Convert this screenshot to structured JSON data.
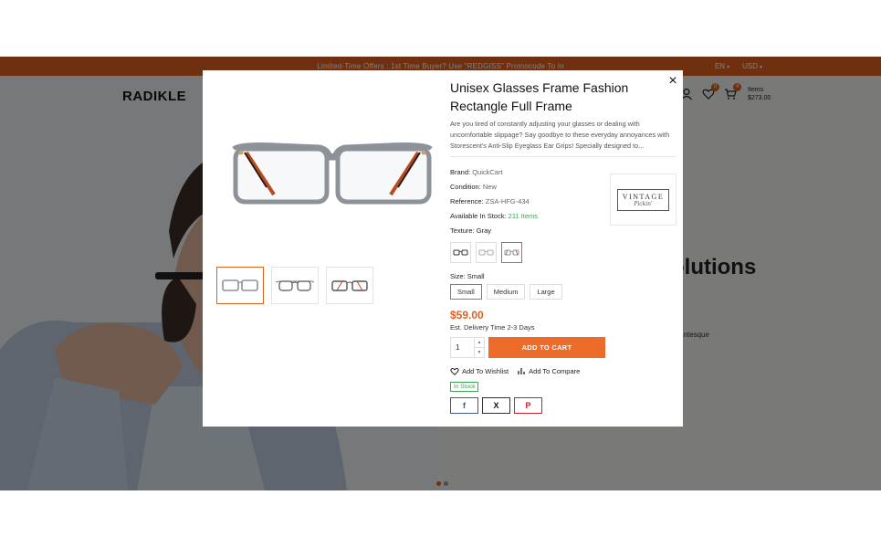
{
  "topbar": {
    "promo": "Limited-Time Offers : 1st Time Buyer? Use \"REDGISS\" Promocode To In",
    "language": "EN",
    "currency": "USD"
  },
  "header": {
    "logo": "RADIKLE",
    "wishlist_count": "0",
    "cart_count": "4",
    "cart_label": "Items",
    "cart_total": "$273.00",
    "icons": [
      "user-icon",
      "heart-icon",
      "cart-icon"
    ]
  },
  "hero": {
    "title": "olutions",
    "text_fragment": "entesque"
  },
  "modal": {
    "close": "×",
    "product": {
      "title": "Unisex Glasses Frame Fashion Rectangle Full Frame",
      "description": "Are you tired of constantly adjusting your glasses or dealing with uncomfortable slippage? Say goodbye to these everyday annoyances with Storescent's Anti-Slip Eyeglass Ear Grips! Specially designed to...",
      "brand_label": "Brand:",
      "brand": "QuickCart",
      "condition_label": "Condition:",
      "condition": "New",
      "reference_label": "Reference:",
      "reference": "ZSA-HFG-434",
      "stock_label": "Available In Stock:",
      "stock": "211 Items",
      "texture_label": "Texture:",
      "texture": "Gray",
      "size_label": "Size:",
      "size": "Small",
      "sizes": [
        "Small",
        "Medium",
        "Large"
      ],
      "price": "$59.00",
      "delivery": "Est. Delivery Time 2-3 Days",
      "quantity": "1",
      "add_to_cart": "ADD TO CART",
      "wishlist": "Add To Wishlist",
      "compare": "Add To Compare",
      "in_stock_badge": "In Stock"
    },
    "brand_logo": {
      "line1": "VINTAGE",
      "line2": "Pickin'"
    },
    "share": [
      "f",
      "X",
      "P"
    ]
  },
  "colors": {
    "accent": "#e05f1f",
    "button": "#ee6c2a",
    "stock": "#3aa655",
    "facebook": "#3b5998",
    "pinterest": "#cb2027"
  }
}
